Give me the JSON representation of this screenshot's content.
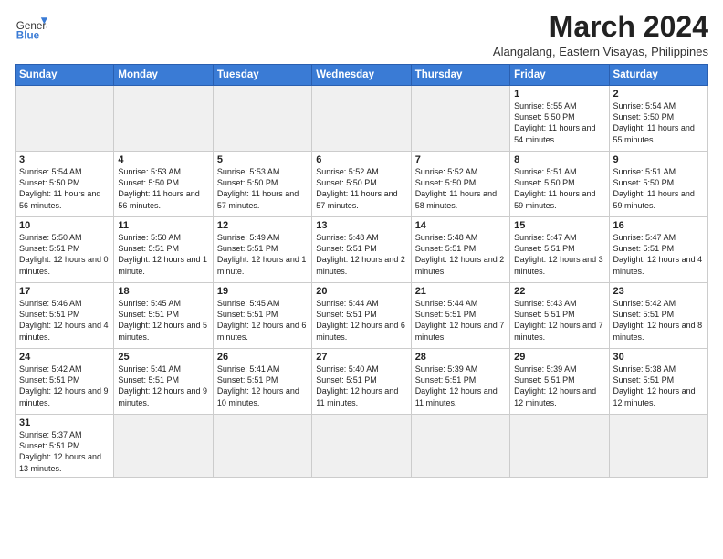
{
  "logo": {
    "text_general": "General",
    "text_blue": "Blue"
  },
  "title": "March 2024",
  "subtitle": "Alangalang, Eastern Visayas, Philippines",
  "days_of_week": [
    "Sunday",
    "Monday",
    "Tuesday",
    "Wednesday",
    "Thursday",
    "Friday",
    "Saturday"
  ],
  "weeks": [
    [
      {
        "day": "",
        "info": "",
        "empty": true
      },
      {
        "day": "",
        "info": "",
        "empty": true
      },
      {
        "day": "",
        "info": "",
        "empty": true
      },
      {
        "day": "",
        "info": "",
        "empty": true
      },
      {
        "day": "",
        "info": "",
        "empty": true
      },
      {
        "day": "1",
        "info": "Sunrise: 5:55 AM\nSunset: 5:50 PM\nDaylight: 11 hours\nand 54 minutes."
      },
      {
        "day": "2",
        "info": "Sunrise: 5:54 AM\nSunset: 5:50 PM\nDaylight: 11 hours\nand 55 minutes."
      }
    ],
    [
      {
        "day": "3",
        "info": "Sunrise: 5:54 AM\nSunset: 5:50 PM\nDaylight: 11 hours\nand 56 minutes."
      },
      {
        "day": "4",
        "info": "Sunrise: 5:53 AM\nSunset: 5:50 PM\nDaylight: 11 hours\nand 56 minutes."
      },
      {
        "day": "5",
        "info": "Sunrise: 5:53 AM\nSunset: 5:50 PM\nDaylight: 11 hours\nand 57 minutes."
      },
      {
        "day": "6",
        "info": "Sunrise: 5:52 AM\nSunset: 5:50 PM\nDaylight: 11 hours\nand 57 minutes."
      },
      {
        "day": "7",
        "info": "Sunrise: 5:52 AM\nSunset: 5:50 PM\nDaylight: 11 hours\nand 58 minutes."
      },
      {
        "day": "8",
        "info": "Sunrise: 5:51 AM\nSunset: 5:50 PM\nDaylight: 11 hours\nand 59 minutes."
      },
      {
        "day": "9",
        "info": "Sunrise: 5:51 AM\nSunset: 5:50 PM\nDaylight: 11 hours\nand 59 minutes."
      }
    ],
    [
      {
        "day": "10",
        "info": "Sunrise: 5:50 AM\nSunset: 5:51 PM\nDaylight: 12 hours\nand 0 minutes."
      },
      {
        "day": "11",
        "info": "Sunrise: 5:50 AM\nSunset: 5:51 PM\nDaylight: 12 hours\nand 1 minute."
      },
      {
        "day": "12",
        "info": "Sunrise: 5:49 AM\nSunset: 5:51 PM\nDaylight: 12 hours\nand 1 minute."
      },
      {
        "day": "13",
        "info": "Sunrise: 5:48 AM\nSunset: 5:51 PM\nDaylight: 12 hours\nand 2 minutes."
      },
      {
        "day": "14",
        "info": "Sunrise: 5:48 AM\nSunset: 5:51 PM\nDaylight: 12 hours\nand 2 minutes."
      },
      {
        "day": "15",
        "info": "Sunrise: 5:47 AM\nSunset: 5:51 PM\nDaylight: 12 hours\nand 3 minutes."
      },
      {
        "day": "16",
        "info": "Sunrise: 5:47 AM\nSunset: 5:51 PM\nDaylight: 12 hours\nand 4 minutes."
      }
    ],
    [
      {
        "day": "17",
        "info": "Sunrise: 5:46 AM\nSunset: 5:51 PM\nDaylight: 12 hours\nand 4 minutes."
      },
      {
        "day": "18",
        "info": "Sunrise: 5:45 AM\nSunset: 5:51 PM\nDaylight: 12 hours\nand 5 minutes."
      },
      {
        "day": "19",
        "info": "Sunrise: 5:45 AM\nSunset: 5:51 PM\nDaylight: 12 hours\nand 6 minutes."
      },
      {
        "day": "20",
        "info": "Sunrise: 5:44 AM\nSunset: 5:51 PM\nDaylight: 12 hours\nand 6 minutes."
      },
      {
        "day": "21",
        "info": "Sunrise: 5:44 AM\nSunset: 5:51 PM\nDaylight: 12 hours\nand 7 minutes."
      },
      {
        "day": "22",
        "info": "Sunrise: 5:43 AM\nSunset: 5:51 PM\nDaylight: 12 hours\nand 7 minutes."
      },
      {
        "day": "23",
        "info": "Sunrise: 5:42 AM\nSunset: 5:51 PM\nDaylight: 12 hours\nand 8 minutes."
      }
    ],
    [
      {
        "day": "24",
        "info": "Sunrise: 5:42 AM\nSunset: 5:51 PM\nDaylight: 12 hours\nand 9 minutes."
      },
      {
        "day": "25",
        "info": "Sunrise: 5:41 AM\nSunset: 5:51 PM\nDaylight: 12 hours\nand 9 minutes."
      },
      {
        "day": "26",
        "info": "Sunrise: 5:41 AM\nSunset: 5:51 PM\nDaylight: 12 hours\nand 10 minutes."
      },
      {
        "day": "27",
        "info": "Sunrise: 5:40 AM\nSunset: 5:51 PM\nDaylight: 12 hours\nand 11 minutes."
      },
      {
        "day": "28",
        "info": "Sunrise: 5:39 AM\nSunset: 5:51 PM\nDaylight: 12 hours\nand 11 minutes."
      },
      {
        "day": "29",
        "info": "Sunrise: 5:39 AM\nSunset: 5:51 PM\nDaylight: 12 hours\nand 12 minutes."
      },
      {
        "day": "30",
        "info": "Sunrise: 5:38 AM\nSunset: 5:51 PM\nDaylight: 12 hours\nand 12 minutes."
      }
    ],
    [
      {
        "day": "31",
        "info": "Sunrise: 5:37 AM\nSunset: 5:51 PM\nDaylight: 12 hours\nand 13 minutes."
      },
      {
        "day": "",
        "info": "",
        "empty": true
      },
      {
        "day": "",
        "info": "",
        "empty": true
      },
      {
        "day": "",
        "info": "",
        "empty": true
      },
      {
        "day": "",
        "info": "",
        "empty": true
      },
      {
        "day": "",
        "info": "",
        "empty": true
      },
      {
        "day": "",
        "info": "",
        "empty": true
      }
    ]
  ]
}
